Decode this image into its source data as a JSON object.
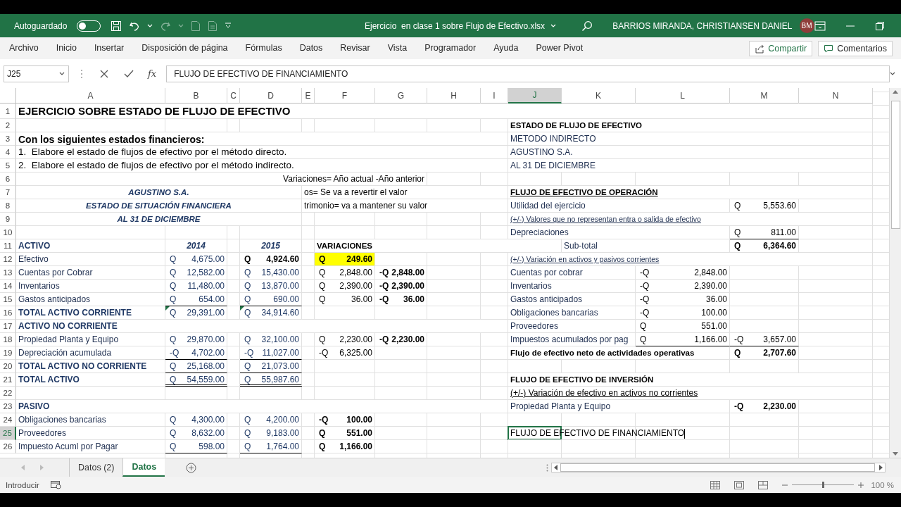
{
  "title_bar": {
    "autosave_label": "Autoguardado",
    "autosave_on": false,
    "file_name": "Ejercicio  en clase 1 sobre Flujo de Efectivo.xlsx",
    "user_name": "BARRIOS MIRANDA, CHRISTIANSEN DANIEL",
    "user_initials": "BM"
  },
  "ribbon": {
    "tabs": [
      {
        "label": "Archivo",
        "selected": false
      },
      {
        "label": "Inicio",
        "selected": false
      },
      {
        "label": "Insertar",
        "selected": false
      },
      {
        "label": "Disposición de página",
        "selected": false
      },
      {
        "label": "Fórmulas",
        "selected": false
      },
      {
        "label": "Datos",
        "selected": false
      },
      {
        "label": "Revisar",
        "selected": false
      },
      {
        "label": "Vista",
        "selected": false
      },
      {
        "label": "Programador",
        "selected": false
      },
      {
        "label": "Ayuda",
        "selected": false
      },
      {
        "label": "Power Pivot",
        "selected": false
      }
    ],
    "share_button": "Compartir",
    "comments_button": "Comentarios"
  },
  "formula_bar": {
    "name_box": "J25",
    "function_label": "fx",
    "value": "FLUJO DE EFECTIVO DE FINANCIAMIENTO"
  },
  "sheet": {
    "columns": [
      {
        "label": "A",
        "selected": false
      },
      {
        "label": "B",
        "selected": false
      },
      {
        "label": "C",
        "selected": false
      },
      {
        "label": "D",
        "selected": false
      },
      {
        "label": "E",
        "selected": false
      },
      {
        "label": "F",
        "selected": false
      },
      {
        "label": "G",
        "selected": false
      },
      {
        "label": "H",
        "selected": false
      },
      {
        "label": "I",
        "selected": false
      },
      {
        "label": "J",
        "selected": true
      },
      {
        "label": "K",
        "selected": false
      },
      {
        "label": "L",
        "selected": false
      },
      {
        "label": "M",
        "selected": false
      },
      {
        "label": "N",
        "selected": false
      }
    ],
    "rows": [
      {
        "number": "1",
        "selected": false,
        "cells": {
          "A": {
            "kind": "title",
            "text": "EJERCICIO SOBRE ESTADO DE FLUJO DE EFECTIVO"
          }
        }
      },
      {
        "number": "2",
        "selected": false,
        "cells": {
          "J": {
            "kind": "header",
            "text": "ESTADO DE FLUJO DE EFECTIVO"
          }
        }
      },
      {
        "number": "3",
        "selected": false,
        "cells": {
          "A": {
            "kind": "subtitle",
            "text": "Con los siguientes estados financieros:"
          },
          "J": {
            "kind": "label",
            "text": "METODO INDIRECTO"
          }
        }
      },
      {
        "number": "4",
        "selected": false,
        "cells": {
          "A": {
            "kind": "instruction",
            "text": "1.  Elabore el estado de flujos de efectivo por el método directo."
          },
          "J": {
            "kind": "label",
            "text": "AGUSTINO S.A."
          }
        }
      },
      {
        "number": "5",
        "selected": false,
        "cells": {
          "A": {
            "kind": "instruction",
            "text": "2.  Elabore el estado de flujos de efectivo por el método indirecto."
          },
          "J": {
            "kind": "label",
            "text": "AL 31 DE DICIEMBRE"
          }
        }
      },
      {
        "number": "6",
        "selected": false,
        "cells": {
          "G": {
            "kind": "note_right",
            "text": "Variaciones= Año actual -Año anterior"
          }
        }
      },
      {
        "number": "7",
        "selected": false,
        "cells": {
          "A": {
            "kind": "company",
            "text": "AGUSTINO S.A."
          },
          "E": {
            "kind": "note",
            "text": "os= Se va a revertir el valor"
          },
          "J": {
            "kind": "header_underlined",
            "text": "FLUJO DE EFECTIVO DE OPERACIÓN"
          }
        }
      },
      {
        "number": "8",
        "selected": false,
        "cells": {
          "A": {
            "kind": "company",
            "text": "ESTADO DE SITUACIÓN FINANCIERA"
          },
          "E": {
            "kind": "note",
            "text": "trimonio= va a mantener su valor"
          },
          "J": {
            "kind": "label",
            "text": "Utilidad del ejercicio"
          },
          "M": {
            "kind": "amount_plain",
            "currency": "Q",
            "text": "5,553.60"
          }
        }
      },
      {
        "number": "9",
        "selected": false,
        "cells": {
          "A": {
            "kind": "company",
            "text": "AL 31 DE DICIEMBRE"
          },
          "J": {
            "kind": "subnote",
            "text": "(+/-) Valores que no representan entra o salida de efectivo"
          }
        }
      },
      {
        "number": "10",
        "selected": false,
        "cells": {
          "J": {
            "kind": "label",
            "text": "Depreciaciones"
          },
          "M": {
            "kind": "amount_plain",
            "currency": "Q",
            "text": "811.00",
            "bottom_border": true
          }
        }
      },
      {
        "number": "11",
        "selected": false,
        "cells": {
          "A": {
            "kind": "section",
            "text": "ACTIVO"
          },
          "B": {
            "kind": "year",
            "text": "2014"
          },
          "D": {
            "kind": "year",
            "text": "2015"
          },
          "F": {
            "kind": "header",
            "text": "VARIACIONES"
          },
          "K": {
            "kind": "label",
            "text": "Sub-total"
          },
          "M": {
            "kind": "amount_strong",
            "currency": "Q",
            "text": "6,364.60"
          }
        }
      },
      {
        "number": "12",
        "selected": false,
        "cells": {
          "A": {
            "kind": "label",
            "text": "Efectivo"
          },
          "B": {
            "kind": "amount",
            "currency": "Q",
            "text": "4,675.00"
          },
          "D": {
            "kind": "amount_strong",
            "currency": "Q",
            "text": "4,924.60"
          },
          "F": {
            "kind": "amount_highlight",
            "currency": "Q",
            "text": "249.60"
          },
          "J": {
            "kind": "subnote",
            "text": "(+/-) Variación en activos y pasivos corrientes"
          }
        }
      },
      {
        "number": "13",
        "selected": false,
        "cells": {
          "A": {
            "kind": "label",
            "text": "Cuentas por Cobrar"
          },
          "B": {
            "kind": "amount",
            "currency": "Q",
            "text": "12,582.00"
          },
          "D": {
            "kind": "amount",
            "currency": "Q",
            "text": "15,430.00"
          },
          "F": {
            "kind": "amount_plain",
            "currency": "Q",
            "text": "2,848.00"
          },
          "G": {
            "kind": "amount_strong",
            "currency": "-Q",
            "text": "2,848.00"
          },
          "J": {
            "kind": "label",
            "text": "Cuentas por cobrar"
          },
          "L": {
            "kind": "amount_plain",
            "currency": "-Q",
            "text": "2,848.00"
          }
        }
      },
      {
        "number": "14",
        "selected": false,
        "cells": {
          "A": {
            "kind": "label",
            "text": "Inventarios"
          },
          "B": {
            "kind": "amount",
            "currency": "Q",
            "text": "11,480.00"
          },
          "D": {
            "kind": "amount",
            "currency": "Q",
            "text": "13,870.00"
          },
          "F": {
            "kind": "amount_plain",
            "currency": "Q",
            "text": "2,390.00"
          },
          "G": {
            "kind": "amount_strong",
            "currency": "-Q",
            "text": "2,390.00"
          },
          "J": {
            "kind": "label",
            "text": "Inventarios"
          },
          "L": {
            "kind": "amount_plain",
            "currency": "-Q",
            "text": "2,390.00"
          }
        }
      },
      {
        "number": "15",
        "selected": false,
        "cells": {
          "A": {
            "kind": "label",
            "text": "Gastos anticipados"
          },
          "B": {
            "kind": "amount",
            "currency": "Q",
            "text": "654.00",
            "bottom_border": true
          },
          "D": {
            "kind": "amount",
            "currency": "Q",
            "text": "690.00",
            "bottom_border": true
          },
          "F": {
            "kind": "amount_plain",
            "currency": "Q",
            "text": "36.00"
          },
          "G": {
            "kind": "amount_strong",
            "currency": "-Q",
            "text": "36.00"
          },
          "J": {
            "kind": "label",
            "text": "Gastos anticipados"
          },
          "L": {
            "kind": "amount_plain",
            "currency": "-Q",
            "text": "36.00"
          }
        }
      },
      {
        "number": "16",
        "selected": false,
        "cells": {
          "A": {
            "kind": "section",
            "text": "TOTAL ACTIVO CORRIENTE"
          },
          "B": {
            "kind": "amount",
            "currency": "Q",
            "text": "29,391.00",
            "error_flag": true
          },
          "D": {
            "kind": "amount",
            "currency": "Q",
            "text": "34,914.60",
            "error_flag": true
          },
          "J": {
            "kind": "label",
            "text": "Obligaciones bancarias"
          },
          "L": {
            "kind": "amount_plain",
            "currency": "-Q",
            "text": "100.00"
          }
        }
      },
      {
        "number": "17",
        "selected": false,
        "cells": {
          "A": {
            "kind": "section",
            "text": "ACTIVO NO CORRIENTE"
          },
          "J": {
            "kind": "label",
            "text": "Proveedores"
          },
          "L": {
            "kind": "amount_plain",
            "currency": "Q",
            "text": "551.00"
          }
        }
      },
      {
        "number": "18",
        "selected": false,
        "cells": {
          "A": {
            "kind": "label",
            "text": "Propiedad Planta y Equipo"
          },
          "B": {
            "kind": "amount",
            "currency": "Q",
            "text": "29,870.00"
          },
          "D": {
            "kind": "amount",
            "currency": "Q",
            "text": "32,100.00"
          },
          "F": {
            "kind": "amount_plain",
            "currency": "Q",
            "text": "2,230.00"
          },
          "G": {
            "kind": "amount_strong",
            "currency": "-Q",
            "text": "2,230.00"
          },
          "J": {
            "kind": "label",
            "text": "Impuestos acumulados por pag"
          },
          "L": {
            "kind": "amount_plain",
            "currency": "Q",
            "text": "1,166.00",
            "bottom_border": true
          },
          "M": {
            "kind": "amount_plain",
            "currency": "-Q",
            "text": "3,657.00",
            "bottom_border": true
          }
        }
      },
      {
        "number": "19",
        "selected": false,
        "cells": {
          "A": {
            "kind": "label",
            "text": "Depreciación acumulada"
          },
          "B": {
            "kind": "amount",
            "currency": "-Q",
            "text": "4,702.00",
            "bottom_border": true
          },
          "D": {
            "kind": "amount",
            "currency": "-Q",
            "text": "11,027.00",
            "bottom_border": true
          },
          "F": {
            "kind": "amount_plain",
            "currency": "-Q",
            "text": "6,325.00"
          },
          "J": {
            "kind": "header",
            "text": "Flujo de efectivo neto de actividades operativas"
          },
          "M": {
            "kind": "amount_strong",
            "currency": "Q",
            "text": "2,707.60"
          }
        }
      },
      {
        "number": "20",
        "selected": false,
        "cells": {
          "A": {
            "kind": "section",
            "text": "TOTAL ACTIVO NO CORRIENTE"
          },
          "B": {
            "kind": "amount",
            "currency": "Q",
            "text": "25,168.00",
            "bottom_border": true
          },
          "D": {
            "kind": "amount",
            "currency": "Q",
            "text": "21,073.00",
            "bottom_border": true
          }
        }
      },
      {
        "number": "21",
        "selected": false,
        "cells": {
          "A": {
            "kind": "section",
            "text": "TOTAL ACTIVO"
          },
          "B": {
            "kind": "amount",
            "currency": "Q",
            "text": "54,559.00",
            "double_bottom_border": true
          },
          "D": {
            "kind": "amount",
            "currency": "Q",
            "text": "55,987.60",
            "double_bottom_border": true
          },
          "J": {
            "kind": "header",
            "text": "FLUJO DE EFECTIVO DE INVERSIÓN"
          }
        }
      },
      {
        "number": "22",
        "selected": false,
        "cells": {
          "J": {
            "kind": "underlined",
            "text": "(+/-) Variación de efectivo en activos no corrientes"
          }
        }
      },
      {
        "number": "23",
        "selected": false,
        "cells": {
          "A": {
            "kind": "section",
            "text": "PASIVO"
          },
          "J": {
            "kind": "label",
            "text": "Propiedad Planta y Equipo"
          },
          "M": {
            "kind": "amount_strong",
            "currency": "-Q",
            "text": "2,230.00"
          }
        }
      },
      {
        "number": "24",
        "selected": false,
        "cells": {
          "A": {
            "kind": "label",
            "text": "Obligaciones bancarias"
          },
          "B": {
            "kind": "amount",
            "currency": "Q",
            "text": "4,300.00"
          },
          "D": {
            "kind": "amount",
            "currency": "Q",
            "text": "4,200.00"
          },
          "F": {
            "kind": "amount_strong",
            "currency": "-Q",
            "text": "100.00"
          }
        }
      },
      {
        "number": "25",
        "selected": true,
        "cells": {
          "A": {
            "kind": "label",
            "text": "Proveedores"
          },
          "B": {
            "kind": "amount",
            "currency": "Q",
            "text": "8,632.00"
          },
          "D": {
            "kind": "amount",
            "currency": "Q",
            "text": "9,183.00"
          },
          "F": {
            "kind": "amount_strong",
            "currency": "Q",
            "text": "551.00"
          },
          "J": {
            "kind": "editing",
            "text": "FLUJO DE EFECTIVO DE FINANCIAMIENTO"
          }
        }
      },
      {
        "number": "26",
        "selected": false,
        "cells": {
          "A": {
            "kind": "label",
            "text": "Impuesto Acuml por Pagar"
          },
          "B": {
            "kind": "amount",
            "currency": "Q",
            "text": "598.00",
            "bottom_border": true
          },
          "D": {
            "kind": "amount",
            "currency": "Q",
            "text": "1,764.00",
            "bottom_border": true
          },
          "F": {
            "kind": "amount_strong",
            "currency": "Q",
            "text": "1,166.00"
          }
        }
      }
    ]
  },
  "sheet_tabs": [
    {
      "label": "Datos (2)",
      "selected": false
    },
    {
      "label": "Datos",
      "selected": true
    }
  ],
  "status_bar": {
    "mode": "Introducir",
    "zoom": "100 %",
    "zoom_slider": {
      "level": 0.5
    }
  }
}
